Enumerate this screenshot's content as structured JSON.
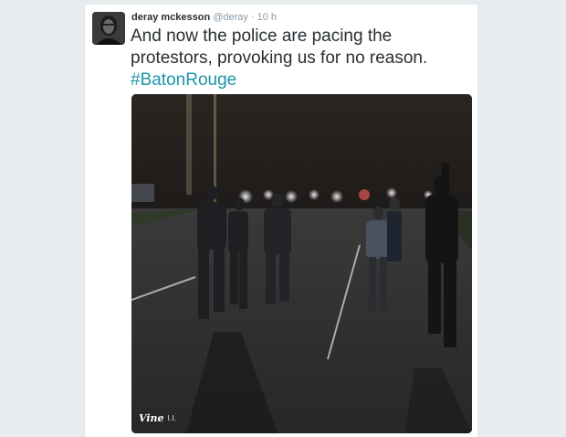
{
  "tweet": {
    "display_name": "deray mckesson",
    "handle": "@deray",
    "separator": "·",
    "time": "10 h",
    "text": "And now the police are pacing the protestors, provoking us for no reason.",
    "hashtag": "#BatonRouge"
  },
  "media": {
    "badge_label": "Vine",
    "badge_suffix": "l.l."
  },
  "colors": {
    "background": "#e9ecee",
    "card": "#ffffff",
    "name": "#292f33",
    "meta": "#8899a6",
    "hashtag": "#1c94a8"
  }
}
